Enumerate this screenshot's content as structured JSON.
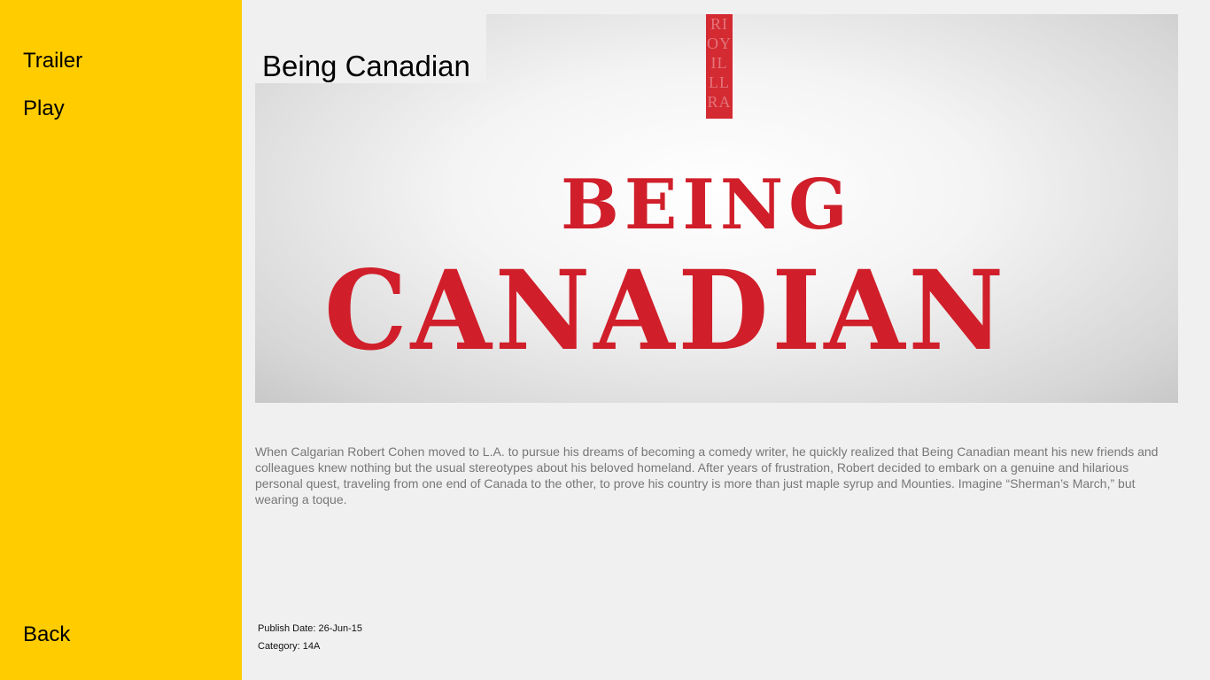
{
  "sidebar": {
    "background": "#ffcc00",
    "items": [
      {
        "label": "Trailer"
      },
      {
        "label": "Play"
      }
    ],
    "back_label": "Back"
  },
  "content": {
    "title": "Being Canadian",
    "poster": {
      "line1": "BEING",
      "line2": "CANADIAN",
      "accent": "#d01f2a"
    },
    "description": "When Calgarian Robert Cohen moved to L.A. to pursue his dreams of becoming a comedy writer, he quickly realized that Being Canadian meant his new friends and colleagues knew nothing but the usual stereotypes about his beloved homeland. After years of frustration, Robert decided to embark on a genuine and hilarious personal quest, traveling from one end of Canada to the other, to prove his country is more than just maple syrup and Mounties. Imagine “Sherman’s March,” but wearing a toque.",
    "publish_date": "Publish Date: 26-Jun-15",
    "category": "Category: 14A"
  }
}
